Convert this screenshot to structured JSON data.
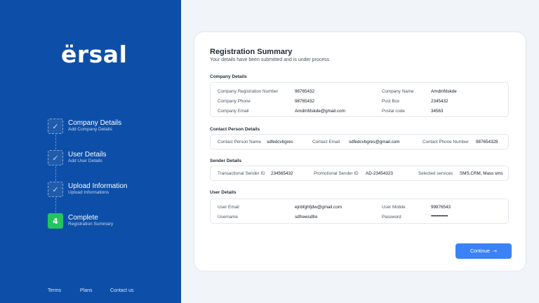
{
  "brand": {
    "logo": "ërsal"
  },
  "steps": [
    {
      "title": "Company Details",
      "subtitle": "Add Company Details",
      "marker": "✓"
    },
    {
      "title": "User Details",
      "subtitle": "Add User Details",
      "marker": "✓"
    },
    {
      "title": "Upload Information",
      "subtitle": "Upload Informations",
      "marker": "✓"
    },
    {
      "title": "Complete",
      "subtitle": "Registration Summary",
      "marker": "4"
    }
  ],
  "footer": {
    "terms": "Terms",
    "plans": "Plans",
    "contact": "Contact us"
  },
  "summary": {
    "title": "Registration Summary",
    "subtitle": "Your details have been submitted and is under process"
  },
  "company": {
    "section_title": "Company Details",
    "registration_number_label": "Company Registration Number",
    "registration_number": "98765432",
    "name_label": "Company Name",
    "name": "Amdmfdskde",
    "phone_label": "Company Phone",
    "phone": "98765432",
    "po_box_label": "Post Box",
    "po_box": "2345432",
    "email_label": "Company Email",
    "email": "Amdmfdskde@gmail.com",
    "postal_code_label": "Postal code",
    "postal_code": "34563"
  },
  "contact": {
    "section_title": "Contact Person Details",
    "name_label": "Contact Person Name",
    "name": "sdfedcvbgres",
    "email_label": "Contact Email",
    "email": "sdfedcvbgres@gmail.com",
    "phone_label": "Contact Phone Number",
    "phone": "987654328"
  },
  "sender": {
    "section_title": "Sender Details",
    "transactional_label": "Transactional Sender ID",
    "transactional": "234565432",
    "promotional_label": "Promotional Sender ID",
    "promotional": "AD-23454323",
    "services_label": "Selected services",
    "services": "SMS,CRM, Mass sms"
  },
  "user": {
    "section_title": "User Details",
    "email_label": "User Email",
    "email": "ejnbfghfjdw@gmail.com",
    "mobile_label": "User Mobile",
    "mobile": "99876543",
    "username_label": "Username",
    "username": "sdfrewsdfre",
    "password_label": "Password",
    "password": "••••••••••••••"
  },
  "actions": {
    "continue_label": "Continue",
    "continue_arrow": "→"
  },
  "colors": {
    "sidebar": "#0d4fa8",
    "active_step": "#22c55e",
    "primary_button": "#3b82f6"
  },
  "icons": {
    "completed_step": "check-icon",
    "continue": "arrow-right-icon"
  }
}
